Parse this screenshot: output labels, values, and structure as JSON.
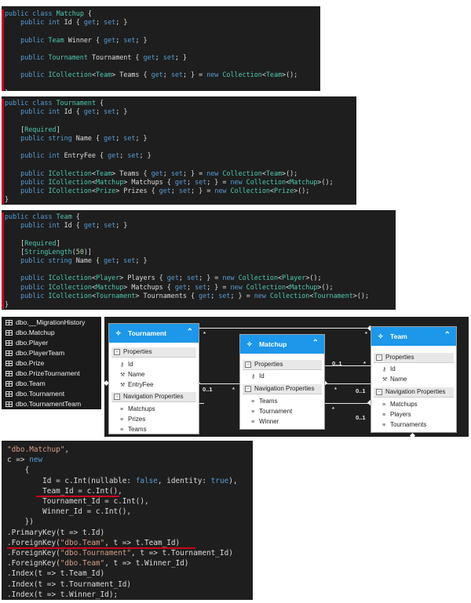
{
  "code_blocks": [
    {
      "id": "matchup-class",
      "lines": [
        [
          [
            "kw",
            "public "
          ],
          [
            "kw",
            "class "
          ],
          [
            "ty",
            "Matchup "
          ],
          [
            "sym",
            "{"
          ]
        ],
        [
          [
            "sym",
            "    "
          ],
          [
            "kw",
            "public "
          ],
          [
            "kw",
            "int "
          ],
          [
            "sym",
            "Id { "
          ],
          [
            "kw",
            "get"
          ],
          [
            "sym",
            "; "
          ],
          [
            "kw",
            "set"
          ],
          [
            "sym",
            "; }"
          ]
        ],
        [],
        [
          [
            "sym",
            "    "
          ],
          [
            "kw",
            "public "
          ],
          [
            "ty",
            "Team "
          ],
          [
            "sym",
            "Winner { "
          ],
          [
            "kw",
            "get"
          ],
          [
            "sym",
            "; "
          ],
          [
            "kw",
            "set"
          ],
          [
            "sym",
            "; }"
          ]
        ],
        [],
        [
          [
            "sym",
            "    "
          ],
          [
            "kw",
            "public "
          ],
          [
            "ty",
            "Tournament "
          ],
          [
            "sym",
            "Tournament { "
          ],
          [
            "kw",
            "get"
          ],
          [
            "sym",
            "; "
          ],
          [
            "kw",
            "set"
          ],
          [
            "sym",
            "; }"
          ]
        ],
        [],
        [
          [
            "sym",
            "    "
          ],
          [
            "kw",
            "public "
          ],
          [
            "ty",
            "ICollection"
          ],
          [
            "sym",
            "<"
          ],
          [
            "ty",
            "Team"
          ],
          [
            "sym",
            "> Teams { "
          ],
          [
            "kw",
            "get"
          ],
          [
            "sym",
            "; "
          ],
          [
            "kw",
            "set"
          ],
          [
            "sym",
            "; } = "
          ],
          [
            "kw",
            "new "
          ],
          [
            "ty",
            "Collection"
          ],
          [
            "sym",
            "<"
          ],
          [
            "ty",
            "Team"
          ],
          [
            "sym",
            ">();"
          ]
        ],
        [],
        [
          [
            "sym",
            "}"
          ]
        ]
      ]
    },
    {
      "id": "tournament-class",
      "lines": [
        [
          [
            "kw",
            "public "
          ],
          [
            "kw",
            "class "
          ],
          [
            "ty",
            "Tournament "
          ],
          [
            "sym",
            "{"
          ]
        ],
        [
          [
            "sym",
            "    "
          ],
          [
            "kw",
            "public "
          ],
          [
            "kw",
            "int "
          ],
          [
            "sym",
            "Id { "
          ],
          [
            "kw",
            "get"
          ],
          [
            "sym",
            "; "
          ],
          [
            "kw",
            "set"
          ],
          [
            "sym",
            "; }"
          ]
        ],
        [],
        [
          [
            "sym",
            "    ["
          ],
          [
            "at",
            "Required"
          ],
          [
            "sym",
            "]"
          ]
        ],
        [
          [
            "sym",
            "    "
          ],
          [
            "kw",
            "public "
          ],
          [
            "kw",
            "string "
          ],
          [
            "sym",
            "Name { "
          ],
          [
            "kw",
            "get"
          ],
          [
            "sym",
            "; "
          ],
          [
            "kw",
            "set"
          ],
          [
            "sym",
            "; }"
          ]
        ],
        [],
        [
          [
            "sym",
            "    "
          ],
          [
            "kw",
            "public "
          ],
          [
            "kw",
            "int "
          ],
          [
            "sym",
            "EntryFee { "
          ],
          [
            "kw",
            "get"
          ],
          [
            "sym",
            "; "
          ],
          [
            "kw",
            "set"
          ],
          [
            "sym",
            "; }"
          ]
        ],
        [],
        [
          [
            "sym",
            "    "
          ],
          [
            "kw",
            "public "
          ],
          [
            "ty",
            "ICollection"
          ],
          [
            "sym",
            "<"
          ],
          [
            "ty",
            "Team"
          ],
          [
            "sym",
            "> Teams { "
          ],
          [
            "kw",
            "get"
          ],
          [
            "sym",
            "; "
          ],
          [
            "kw",
            "set"
          ],
          [
            "sym",
            "; } = "
          ],
          [
            "kw",
            "new "
          ],
          [
            "ty",
            "Collection"
          ],
          [
            "sym",
            "<"
          ],
          [
            "ty",
            "Team"
          ],
          [
            "sym",
            ">();"
          ]
        ],
        [
          [
            "sym",
            "    "
          ],
          [
            "kw",
            "public "
          ],
          [
            "ty",
            "ICollection"
          ],
          [
            "sym",
            "<"
          ],
          [
            "ty",
            "Matchup"
          ],
          [
            "sym",
            "> Matchups { "
          ],
          [
            "kw",
            "get"
          ],
          [
            "sym",
            "; "
          ],
          [
            "kw",
            "set"
          ],
          [
            "sym",
            "; } = "
          ],
          [
            "kw",
            "new "
          ],
          [
            "ty",
            "Collection"
          ],
          [
            "sym",
            "<"
          ],
          [
            "ty",
            "Matchup"
          ],
          [
            "sym",
            ">();"
          ]
        ],
        [
          [
            "sym",
            "    "
          ],
          [
            "kw",
            "public "
          ],
          [
            "ty",
            "ICollection"
          ],
          [
            "sym",
            "<"
          ],
          [
            "ty",
            "Prize"
          ],
          [
            "sym",
            "> Prizes { "
          ],
          [
            "kw",
            "get"
          ],
          [
            "sym",
            "; "
          ],
          [
            "kw",
            "set"
          ],
          [
            "sym",
            "; } = "
          ],
          [
            "kw",
            "new "
          ],
          [
            "ty",
            "Collection"
          ],
          [
            "sym",
            "<"
          ],
          [
            "ty",
            "Prize"
          ],
          [
            "sym",
            ">();"
          ]
        ],
        [
          [
            "sym",
            "}"
          ]
        ]
      ]
    },
    {
      "id": "team-class",
      "lines": [
        [
          [
            "kw",
            "public "
          ],
          [
            "kw",
            "class "
          ],
          [
            "ty",
            "Team "
          ],
          [
            "sym",
            "{"
          ]
        ],
        [
          [
            "sym",
            "    "
          ],
          [
            "kw",
            "public "
          ],
          [
            "kw",
            "int "
          ],
          [
            "sym",
            "Id { "
          ],
          [
            "kw",
            "get"
          ],
          [
            "sym",
            "; "
          ],
          [
            "kw",
            "set"
          ],
          [
            "sym",
            "; }"
          ]
        ],
        [],
        [
          [
            "sym",
            "    ["
          ],
          [
            "at",
            "Required"
          ],
          [
            "sym",
            "]"
          ]
        ],
        [
          [
            "sym",
            "    ["
          ],
          [
            "at",
            "StringLength"
          ],
          [
            "sym",
            "("
          ],
          [
            "num",
            "50"
          ],
          [
            "sym",
            ")]"
          ]
        ],
        [
          [
            "sym",
            "    "
          ],
          [
            "kw",
            "public "
          ],
          [
            "kw",
            "string "
          ],
          [
            "sym",
            "Name { "
          ],
          [
            "kw",
            "get"
          ],
          [
            "sym",
            "; "
          ],
          [
            "kw",
            "set"
          ],
          [
            "sym",
            "; }"
          ]
        ],
        [],
        [
          [
            "sym",
            "    "
          ],
          [
            "kw",
            "public "
          ],
          [
            "ty",
            "ICollection"
          ],
          [
            "sym",
            "<"
          ],
          [
            "ty",
            "Player"
          ],
          [
            "sym",
            "> Players { "
          ],
          [
            "kw",
            "get"
          ],
          [
            "sym",
            "; "
          ],
          [
            "kw",
            "set"
          ],
          [
            "sym",
            "; } = "
          ],
          [
            "kw",
            "new "
          ],
          [
            "ty",
            "Collection"
          ],
          [
            "sym",
            "<"
          ],
          [
            "ty",
            "Player"
          ],
          [
            "sym",
            ">();"
          ]
        ],
        [
          [
            "sym",
            "    "
          ],
          [
            "kw",
            "public "
          ],
          [
            "ty",
            "ICollection"
          ],
          [
            "sym",
            "<"
          ],
          [
            "ty",
            "Matchup"
          ],
          [
            "sym",
            "> Matchups { "
          ],
          [
            "kw",
            "get"
          ],
          [
            "sym",
            "; "
          ],
          [
            "kw",
            "set"
          ],
          [
            "sym",
            "; } = "
          ],
          [
            "kw",
            "new "
          ],
          [
            "ty",
            "Collection"
          ],
          [
            "sym",
            "<"
          ],
          [
            "ty",
            "Matchup"
          ],
          [
            "sym",
            ">();"
          ]
        ],
        [
          [
            "sym",
            "    "
          ],
          [
            "kw",
            "public "
          ],
          [
            "ty",
            "ICollection"
          ],
          [
            "sym",
            "<"
          ],
          [
            "ty",
            "Tournament"
          ],
          [
            "sym",
            "> Tournaments { "
          ],
          [
            "kw",
            "get"
          ],
          [
            "sym",
            "; "
          ],
          [
            "kw",
            "set"
          ],
          [
            "sym",
            "; } = "
          ],
          [
            "kw",
            "new "
          ],
          [
            "ty",
            "Collection"
          ],
          [
            "sym",
            "<"
          ],
          [
            "ty",
            "Tournament"
          ],
          [
            "sym",
            ">();"
          ]
        ],
        [
          [
            "sym",
            "}"
          ]
        ]
      ]
    },
    {
      "id": "migration-code",
      "lines": [
        [
          [
            "str",
            "\"dbo.Matchup\""
          ],
          [
            "sym",
            ","
          ]
        ],
        [
          [
            "sym",
            "c => "
          ],
          [
            "kw",
            "new"
          ]
        ],
        [
          [
            "sym",
            "    {"
          ]
        ],
        [
          [
            "sym",
            "        Id = c.Int(nullable: "
          ],
          [
            "kw",
            "false"
          ],
          [
            "sym",
            ", identity: "
          ],
          [
            "kw",
            "true"
          ],
          [
            "sym",
            "),"
          ]
        ],
        [
          [
            "sym",
            "        Team_Id = c.Int(),"
          ]
        ],
        [
          [
            "sym",
            "        Tournament_Id = c.Int(),"
          ]
        ],
        [
          [
            "sym",
            "        Winner_Id = c.Int(),"
          ]
        ],
        [
          [
            "sym",
            "    })"
          ]
        ],
        [
          [
            "sym",
            ".PrimaryKey(t => t.Id)"
          ]
        ],
        [
          [
            "sym",
            ".ForeignKey("
          ],
          [
            "str",
            "\"dbo.Team\""
          ],
          [
            "sym",
            ", t => t.Team_Id)"
          ]
        ],
        [
          [
            "sym",
            ".ForeignKey("
          ],
          [
            "str",
            "\"dbo.Tournament\""
          ],
          [
            "sym",
            ", t => t.Tournament_Id)"
          ]
        ],
        [
          [
            "sym",
            ".ForeignKey("
          ],
          [
            "str",
            "\"dbo.Team\""
          ],
          [
            "sym",
            ", t => t.Winner_Id)"
          ]
        ],
        [
          [
            "sym",
            ".Index(t => t.Team_Id)"
          ]
        ],
        [
          [
            "sym",
            ".Index(t => t.Tournament_Id)"
          ]
        ],
        [
          [
            "sym",
            ".Index(t => t.Winner_Id);"
          ]
        ]
      ]
    }
  ],
  "db_tables": [
    "dbo.__MigrationHistory",
    "dbo.Matchup",
    "dbo.Player",
    "dbo.PlayerTeam",
    "dbo.Prize",
    "dbo.PrizeTournament",
    "dbo.Team",
    "dbo.Tournament",
    "dbo.TournamentTeam"
  ],
  "entities": {
    "tournament": {
      "title": "Tournament",
      "properties_label": "Properties",
      "properties": [
        "Id",
        "Name",
        "EntryFee"
      ],
      "nav_label": "Navigation Properties",
      "nav": [
        "Matchups",
        "Prizes",
        "Teams"
      ]
    },
    "matchup": {
      "title": "Matchup",
      "properties_label": "Properties",
      "properties": [
        "Id"
      ],
      "nav_label": "Navigation Properties",
      "nav": [
        "Teams",
        "Tournament",
        "Winner"
      ]
    },
    "team": {
      "title": "Team",
      "properties_label": "Properties",
      "properties": [
        "Id",
        "Name"
      ],
      "nav_label": "Navigation Properties",
      "nav": [
        "Matchups",
        "Players",
        "Tournaments"
      ]
    }
  },
  "cardinalities": {
    "one": "0..1",
    "many": "*"
  },
  "colors": {
    "editor_bg": "#1e1e1e",
    "keyword": "#569cd6",
    "type": "#4ec9b0",
    "string": "#d69d85",
    "entity_header": "#1c97ea",
    "underline": "#c8001e"
  }
}
